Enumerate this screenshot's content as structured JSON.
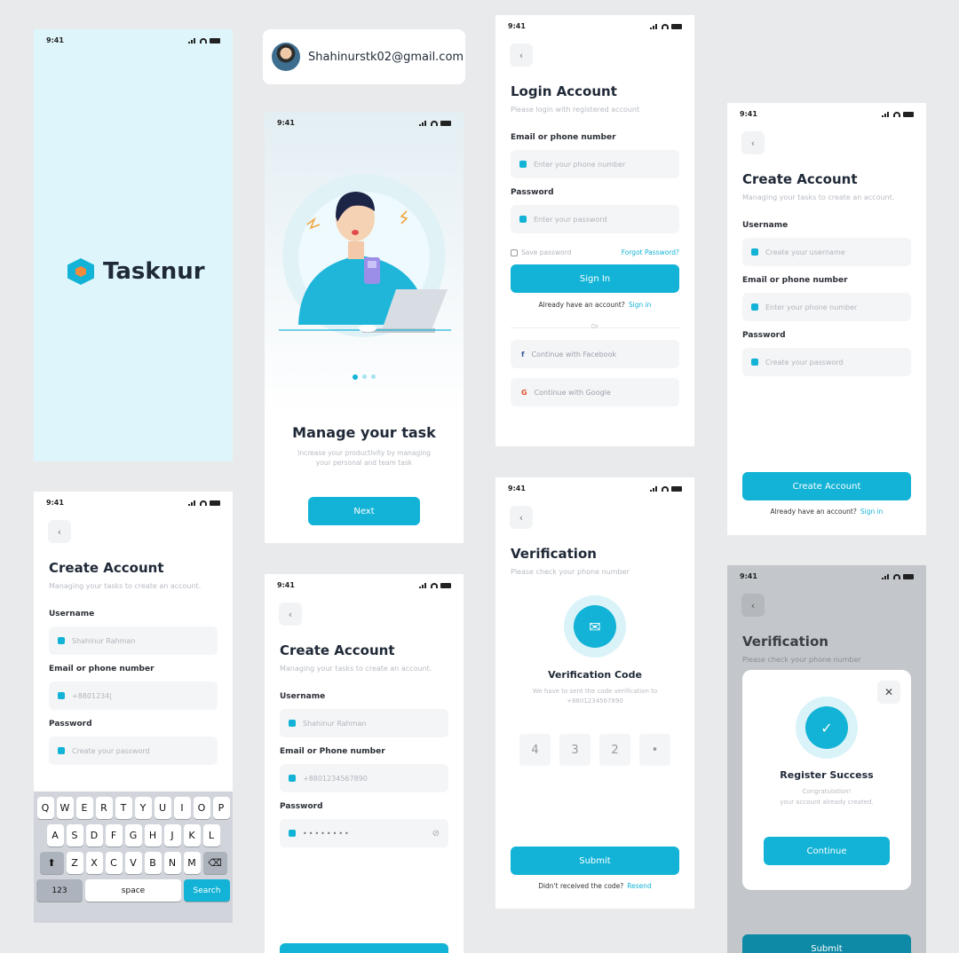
{
  "status_time": "9:41",
  "brand": {
    "name": "Tasknur",
    "accent": "#12b3d6",
    "logo_inner": "#f28b3c"
  },
  "email_chip": {
    "email": "Shahinurstk02@gmail.com"
  },
  "onboarding": {
    "title": "Manage your task",
    "subtitle": "Increase your productivity by managing your personal and team task",
    "next_label": "Next"
  },
  "login": {
    "title": "Login Account",
    "subtitle": "Please login with registered account",
    "email_label": "Email or phone number",
    "email_placeholder": "Enter your phone number",
    "password_label": "Password",
    "password_placeholder": "Enter your password",
    "save_password": "Save password",
    "forgot": "Forgot Password?",
    "signin_button": "Sign In",
    "footer_text": "Already have an account?",
    "footer_link": "Sign in",
    "or": "Or",
    "facebook": "Continue with Facebook",
    "google": "Continue with Google"
  },
  "create_empty": {
    "title": "Create Account",
    "subtitle": "Managing your tasks to create an account.",
    "username_label": "Username",
    "username_placeholder": "Create your username",
    "email_label": "Email or phone number",
    "email_placeholder": "Enter your phone number",
    "password_label": "Password",
    "password_placeholder": "Create your password",
    "button": "Create Account",
    "footer_text": "Already have an account?",
    "footer_link": "Sign in"
  },
  "create_keyboard": {
    "title": "Create Account",
    "subtitle": "Managing your tasks to create an account.",
    "username_label": "Username",
    "username_value": "Shahinur Rahman",
    "email_label": "Email or phone number",
    "email_value": "+8801234|",
    "password_label": "Password",
    "password_placeholder": "Create your password",
    "keys_row1": [
      "Q",
      "W",
      "E",
      "R",
      "T",
      "Y",
      "U",
      "I",
      "O",
      "P"
    ],
    "keys_row2": [
      "A",
      "S",
      "D",
      "F",
      "G",
      "H",
      "J",
      "K",
      "L"
    ],
    "keys_row3": [
      "Z",
      "X",
      "C",
      "V",
      "B",
      "N",
      "M"
    ],
    "key_123": "123",
    "key_space": "space",
    "key_search": "Search"
  },
  "create_filled": {
    "title": "Create Account",
    "subtitle": "Managing your tasks to create an account.",
    "username_label": "Username",
    "username_value": "Shahinur Rahman",
    "email_label": "Email or Phone number",
    "email_value": "+8801234567890",
    "password_label": "Password",
    "password_value": "••••••••"
  },
  "verification": {
    "title": "Verification",
    "subtitle": "Please check your phone number",
    "code_title": "Verification Code",
    "code_text": "We have to sent the code verification to +8801234567890",
    "digits": [
      "4",
      "3",
      "2",
      "•"
    ],
    "submit": "Submit",
    "footer_text": "Didn't received the code?",
    "footer_link": "Resend"
  },
  "success": {
    "title": "Verification",
    "subtitle": "Please check your phone number",
    "modal_title": "Register Success",
    "modal_line1": "Congratulation!",
    "modal_line2": "your account already created.",
    "continue": "Continue",
    "submit": "Submit"
  }
}
